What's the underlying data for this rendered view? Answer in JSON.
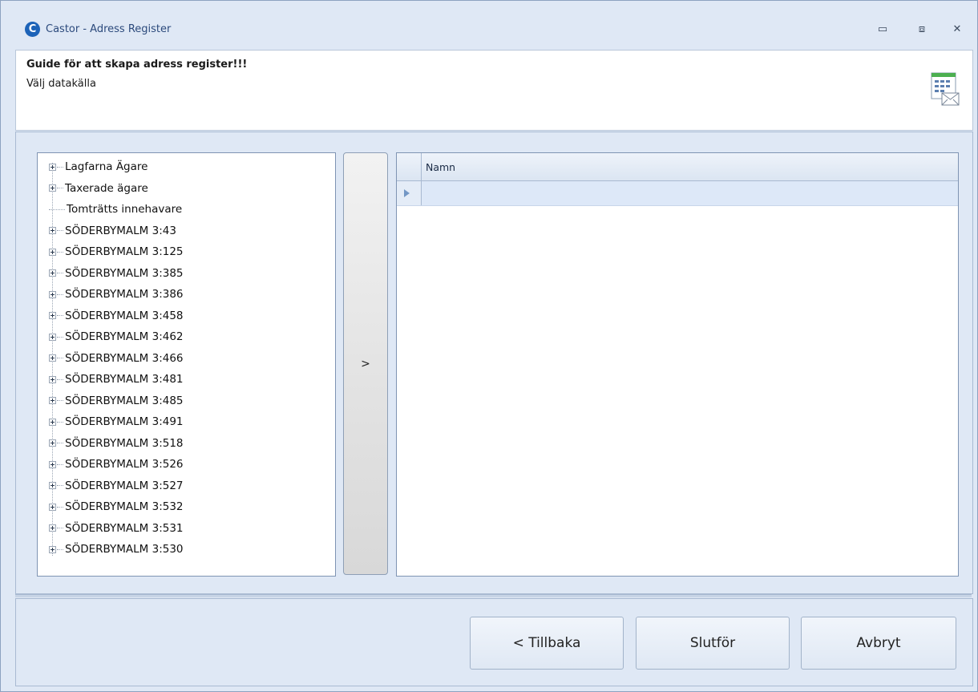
{
  "window": {
    "title": "Castor - Adress Register",
    "app_icon_letter": "C"
  },
  "title_buttons": {
    "minimize": "▭",
    "maximize": "⧈",
    "close": "✕"
  },
  "header": {
    "title": "Guide för att skapa adress register!!!",
    "subtitle": "Välj datakälla",
    "icon": "address-register-mail-icon"
  },
  "tree": {
    "items": [
      {
        "label": "Lagfarna Ägare",
        "expandable": true
      },
      {
        "label": "Taxerade ägare",
        "expandable": true
      },
      {
        "label": "Tomträtts innehavare",
        "expandable": false
      },
      {
        "label": "SÖDERBYMALM 3:43",
        "expandable": true
      },
      {
        "label": "SÖDERBYMALM 3:125",
        "expandable": true
      },
      {
        "label": "SÖDERBYMALM 3:385",
        "expandable": true
      },
      {
        "label": "SÖDERBYMALM 3:386",
        "expandable": true
      },
      {
        "label": "SÖDERBYMALM 3:458",
        "expandable": true
      },
      {
        "label": "SÖDERBYMALM 3:462",
        "expandable": true
      },
      {
        "label": "SÖDERBYMALM 3:466",
        "expandable": true
      },
      {
        "label": "SÖDERBYMALM 3:481",
        "expandable": true
      },
      {
        "label": "SÖDERBYMALM 3:485",
        "expandable": true
      },
      {
        "label": "SÖDERBYMALM 3:491",
        "expandable": true
      },
      {
        "label": "SÖDERBYMALM 3:518",
        "expandable": true
      },
      {
        "label": "SÖDERBYMALM 3:526",
        "expandable": true
      },
      {
        "label": "SÖDERBYMALM 3:527",
        "expandable": true
      },
      {
        "label": "SÖDERBYMALM 3:532",
        "expandable": true
      },
      {
        "label": "SÖDERBYMALM 3:531",
        "expandable": true
      },
      {
        "label": "SÖDERBYMALM 3:530",
        "expandable": true
      }
    ]
  },
  "move_button": {
    "label": ">"
  },
  "grid": {
    "columns": [
      "Namn"
    ],
    "rows": [
      [
        ""
      ]
    ]
  },
  "footer": {
    "back_label": "< Tillbaka",
    "finish_label": "Slutför",
    "cancel_label": "Avbryt"
  },
  "colors": {
    "accent": "#1d63b8",
    "window_bg": "#dfe8f5",
    "selected_row": "#dde8f8"
  }
}
